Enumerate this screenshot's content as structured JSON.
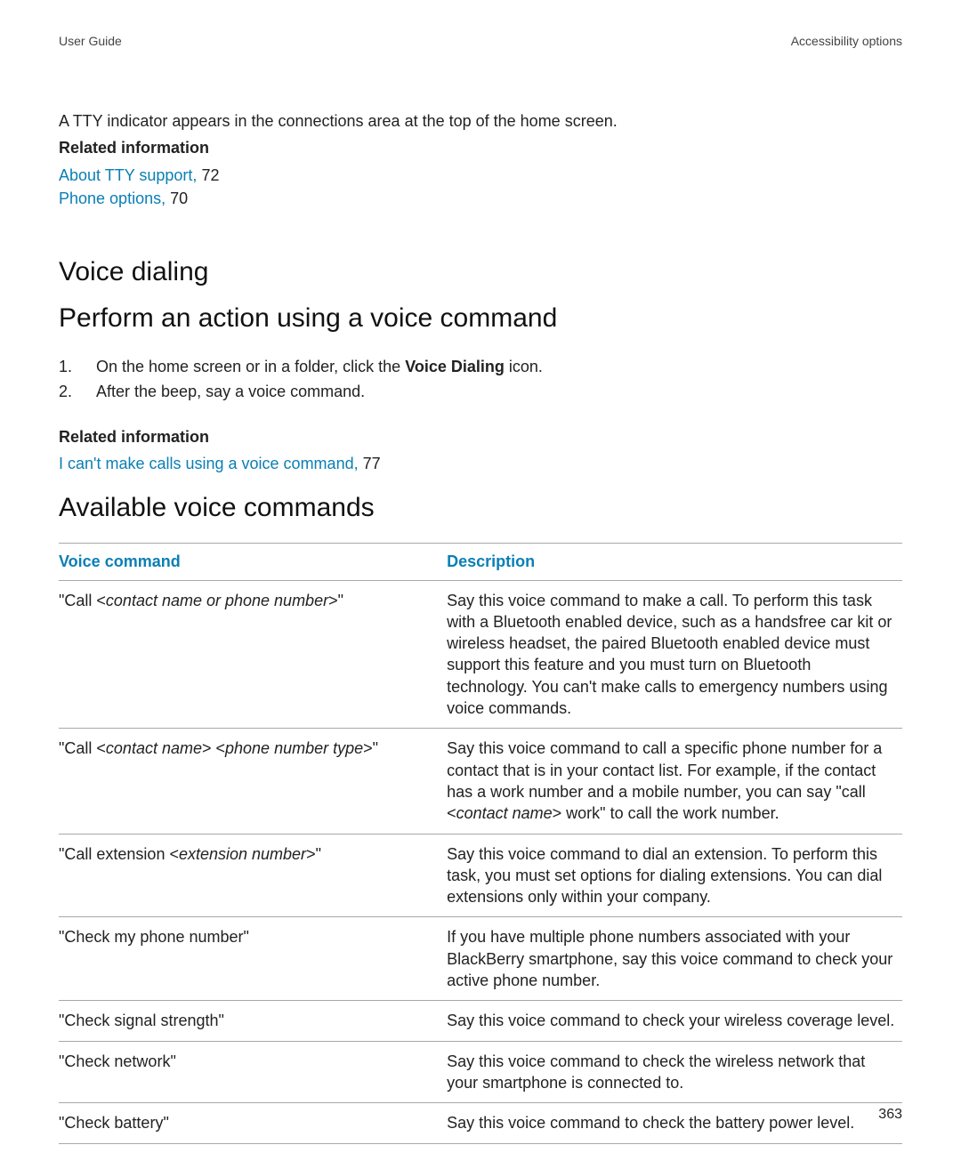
{
  "header": {
    "left": "User Guide",
    "right": "Accessibility options"
  },
  "intro": {
    "tty_note": "A TTY indicator appears in the connections area at the top of the home screen.",
    "related_heading": "Related information",
    "link1": {
      "text": "About TTY support,",
      "page": " 72"
    },
    "link2": {
      "text": "Phone options,",
      "page": " 70"
    }
  },
  "voice_dialing": {
    "heading": "Voice dialing",
    "perform_heading": "Perform an action using a voice command",
    "steps": [
      {
        "num": "1.",
        "pre": "On the home screen or in a folder, click the ",
        "bold": "Voice Dialing",
        "post": " icon."
      },
      {
        "num": "2.",
        "pre": "After the beep, say a voice command.",
        "bold": "",
        "post": ""
      }
    ],
    "related_heading": "Related information",
    "link3": {
      "text": "I can't make calls using a voice command,",
      "page": " 77"
    },
    "avail_heading": "Available voice commands"
  },
  "table": {
    "head": {
      "col1": "Voice command",
      "col2": "Description"
    },
    "rows": [
      {
        "cmd_pre": "\"Call <",
        "cmd_ital": "contact name or phone number",
        "cmd_post": ">\"",
        "desc": "Say this voice command to make a call. To perform this task with a Bluetooth enabled device, such as a handsfree car kit or wireless headset, the paired Bluetooth enabled device must support this feature and you must turn on Bluetooth technology. You can't make calls to emergency numbers using voice commands."
      },
      {
        "cmd_pre": "\"Call <",
        "cmd_ital": "contact name",
        "cmd_mid": "> <",
        "cmd_ital2": "phone number type",
        "cmd_post": ">\"",
        "desc_pre": "Say this voice command to call a specific phone number for a contact that is in your contact list. For example, if the contact has a work number and a mobile number, you can say \"call <",
        "desc_ital": "contact name",
        "desc_post": "> work\" to call the work number."
      },
      {
        "cmd_pre": "\"Call extension <",
        "cmd_ital": "extension number",
        "cmd_post": ">\"",
        "desc": "Say this voice command to dial an extension. To perform this task, you must set options for dialing extensions. You can dial extensions only within your company."
      },
      {
        "cmd_plain": "\"Check my phone number\"",
        "desc": "If you have multiple phone numbers associated with your BlackBerry smartphone, say this voice command to check your active phone number."
      },
      {
        "cmd_plain": "\"Check signal strength\"",
        "desc": "Say this voice command to check your wireless coverage level."
      },
      {
        "cmd_plain": "\"Check network\"",
        "desc": "Say this voice command to check the wireless network that your smartphone is connected to."
      },
      {
        "cmd_plain": "\"Check battery\"",
        "desc": "Say this voice command to check the battery power level."
      }
    ]
  },
  "page_number": "363"
}
